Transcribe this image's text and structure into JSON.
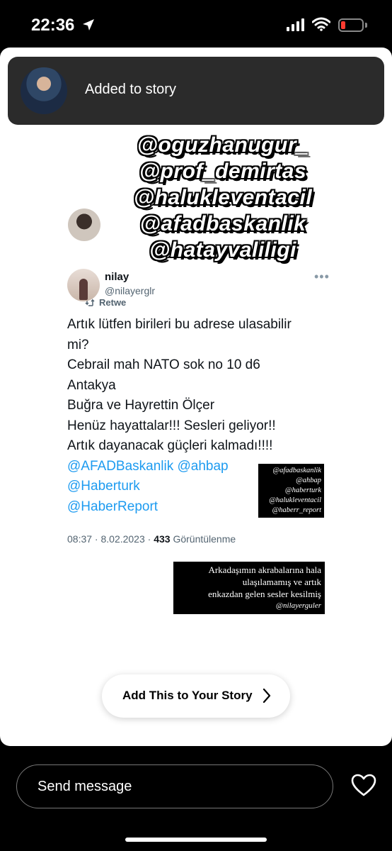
{
  "status": {
    "time": "22:36"
  },
  "toast": {
    "text": "Added to story"
  },
  "mention_overlay": [
    "@oguzhanugur_",
    "@prof_demirtas",
    "@halukleventacil",
    "@afadbaskanlik",
    "@hatayvaliligi"
  ],
  "background_tweet": {
    "retweet_label": "Retwe"
  },
  "tweet": {
    "name": "nilay",
    "handle": "@nilayerglr",
    "more": "•••",
    "lines": [
      "Artık lütfen birileri bu adrese ulasabilir",
      "mi?",
      "Cebrail mah NATO sok no 10 d6",
      "Antakya",
      "Buğra ve Hayrettin  Ölçer",
      "Henüz hayattalar!!! Sesleri geliyor!!",
      "Artık dayanacak güçleri kalmadı!!!!"
    ],
    "mentions_line1": "@AFADBaskanlik @ahbap",
    "mentions_line2": "@Haberturk",
    "mentions_line3": "@HaberReport",
    "meta_prefix": "08:37 · 8.02.2023 · ",
    "views": "433",
    "views_label": " Görüntülenme"
  },
  "sticker_mentions": [
    "@afadbaskanlik",
    "@ahbap",
    "@haberturk",
    "@halukleventacil",
    "@haberr_report"
  ],
  "sticker_note": {
    "lines": [
      "Arkadaşımın akrabalarına hala",
      "ulaşılamamış ve artık",
      "enkazdan gelen sesler kesilmiş"
    ],
    "handle": "@nilayerguler"
  },
  "add_story_button": {
    "label": "Add This to Your Story"
  },
  "message_bar": {
    "placeholder": "Send message"
  }
}
